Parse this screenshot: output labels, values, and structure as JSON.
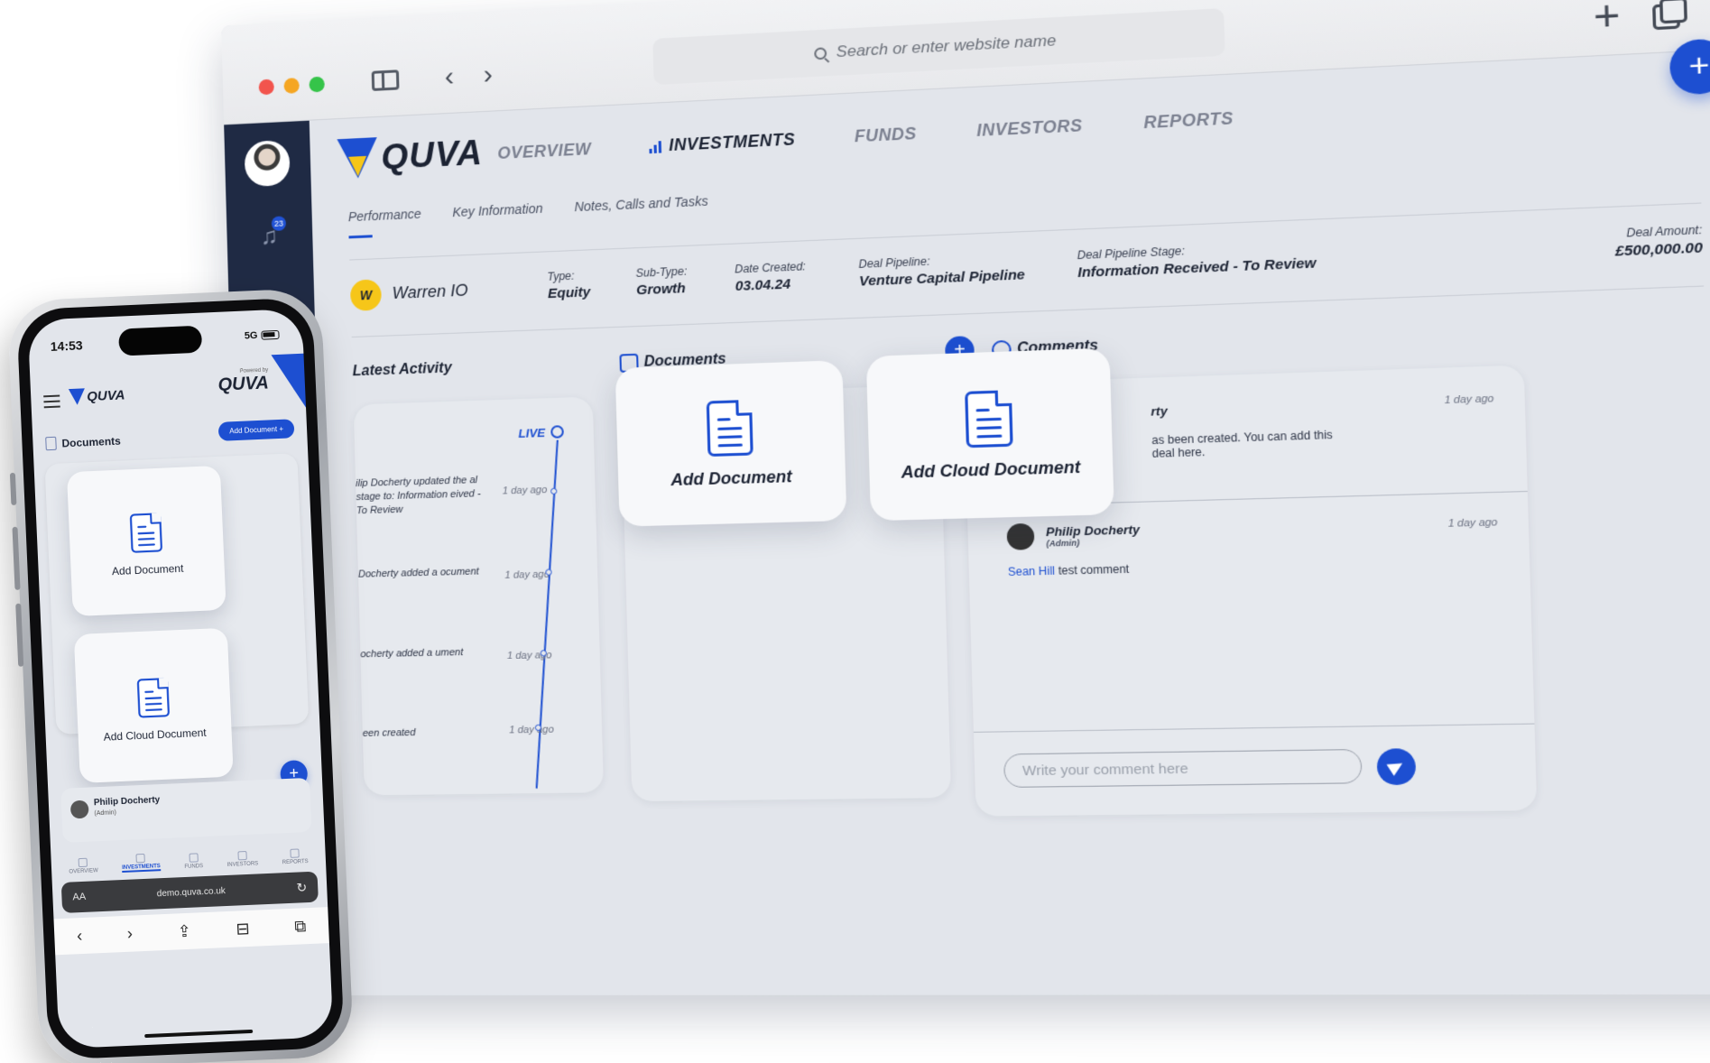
{
  "browser": {
    "url_placeholder": "Search or enter website name",
    "new_tab_glyph": "+",
    "back_glyph": "‹",
    "forward_glyph": "›"
  },
  "app": {
    "brand": "QUVA",
    "nav": [
      {
        "label": "OVERVIEW"
      },
      {
        "label": "INVESTMENTS"
      },
      {
        "label": "FUNDS"
      },
      {
        "label": "INVESTORS"
      },
      {
        "label": "REPORTS"
      }
    ],
    "notification_count": "23",
    "fab_glyph": "+",
    "sub_tabs": [
      "Performance",
      "Key Information",
      "Notes, Calls and Tasks"
    ],
    "deal": {
      "initial": "W",
      "name": "Warren IO",
      "type_label": "Type:",
      "type_value": "Equity",
      "subtype_label": "Sub-Type:",
      "subtype_value": "Growth",
      "created_label": "Date Created:",
      "created_value": "03.04.24",
      "pipeline_label": "Deal Pipeline:",
      "pipeline_value": "Venture Capital Pipeline",
      "stage_label": "Deal Pipeline Stage:",
      "stage_value": "Information Received - To Review",
      "amount_label": "Deal Amount:",
      "amount_value": "£500,000.00"
    },
    "sections": {
      "activity": "Latest Activity",
      "documents": "Documents",
      "comments": "Comments"
    },
    "live_label": "LIVE",
    "activity": [
      {
        "text": "ilip Docherty updated the al stage to: Information eived - To Review",
        "when": "1 day ago"
      },
      {
        "text": "Docherty added a ocument",
        "when": "1 day ago"
      },
      {
        "text": "ocherty added a ument",
        "when": "1 day ago"
      },
      {
        "text": "een created",
        "when": "1 day ago"
      }
    ],
    "comments": [
      {
        "name": "rty",
        "when": "1 day ago",
        "body": "as been created. You can add this deal here."
      },
      {
        "name": "Philip Docherty",
        "role": "(Admin)",
        "when": "1 day ago",
        "mention": "Sean Hill",
        "body": "test comment"
      }
    ],
    "comment_placeholder": "Write your comment here",
    "tiles": {
      "add_document": "Add Document",
      "add_cloud_document": "Add Cloud Document"
    }
  },
  "phone": {
    "time": "14:53",
    "network": "5G",
    "brand": "QUVA",
    "powered_by": "Powered by",
    "documents_title": "Documents",
    "add_document_button": "Add Document",
    "tile_add_document": "Add Document",
    "tile_add_cloud_document": "Add Cloud Document",
    "comment_name": "Philip Docherty",
    "comment_role": "(Admin)",
    "tabs": [
      "OVERVIEW",
      "INVESTMENTS",
      "FUNDS",
      "INVESTORS",
      "REPORTS"
    ],
    "url_aa": "AA",
    "url": "demo.quva.co.uk",
    "reload_glyph": "↻"
  },
  "colors": {
    "accent": "#1d4fd1",
    "brand_yellow": "#f6c619",
    "sidebar": "#1f2a44"
  },
  "icons": [
    "search-icon",
    "sidebar-icon",
    "back-icon",
    "forward-icon",
    "new-tab-icon",
    "tabs-icon",
    "bell-icon",
    "bar-chart-icon",
    "document-icon",
    "comment-icon",
    "send-icon",
    "hamburger-icon"
  ]
}
